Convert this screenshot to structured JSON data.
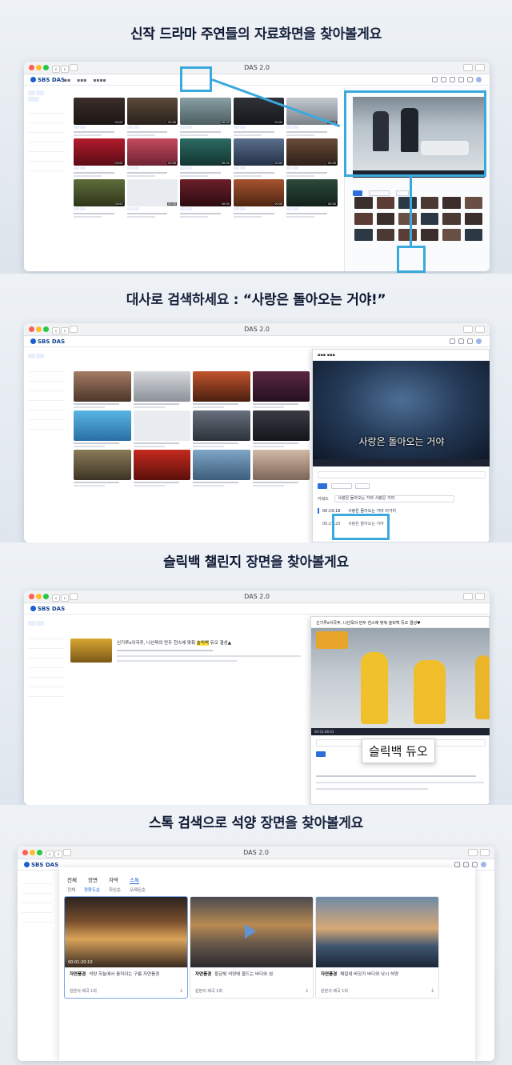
{
  "sections": [
    {
      "heading_bold": "신작 드라마 주연",
      "heading_rest": "들의 자료화면을 찾아볼게요",
      "window_title": "DAS 2.0"
    },
    {
      "heading_prefix": "대사로 검색하세요 : ",
      "heading_bold": "“사랑은 돌아오는 거야!”",
      "window_title": "DAS 2.0",
      "subtitle": "사랑은 돌아오는 거야",
      "keyword_label": "키워드",
      "keyword_value": "사랑은 돌아오는 거야 사랑은 거야",
      "result_time": "00:19:18",
      "result_text": "사랑은 돌아오는 거야 이거지",
      "result_time2": "00:19:20",
      "result_text2": "사랑은 돌아오는 거야"
    },
    {
      "heading_bold": "슬릭백 챌린지",
      "heading_rest": " 장면을 찾아볼게요",
      "window_title": "DAS 2.0",
      "player_title": "신기루x이국주, 나선욱의 만두 천스에 맞춰 슬릭백 듀오 결성♥",
      "result_title_pre": "신기루x이국주, 나선욱의 만두 천스에 맞춰 ",
      "result_title_hl": "슬릭백",
      "result_title_post": " 듀오 결성▲",
      "search_callout": "슬릭백 듀오",
      "player_time": "00:01:08:01"
    },
    {
      "heading_bold1": "스톡 검색",
      "heading_mid": "으로 ",
      "heading_bold2": "석양",
      "heading_rest": " 장면을 찾아볼게요",
      "window_title": "DAS 2.0",
      "logo": "SBS DAS",
      "tabs": [
        "전체",
        "장면",
        "자막",
        "스톡"
      ],
      "subtabs": [
        "전체",
        "정확도순",
        "최신순",
        "오래된순"
      ],
      "cards": [
        {
          "category": "자연풍경",
          "desc": "석양 하늘에서 움직이는 구름 자연풍경",
          "time": "00:01:20:10",
          "count": "원본의 왜곡 1회"
        },
        {
          "category": "자연풍경",
          "desc": "황금빛 석양에 물드는 바다와 섬",
          "time": "",
          "count": "원본의 왜곡 1회"
        },
        {
          "category": "자연풍경",
          "desc": "해질녘 바닷가 바다와 낚시 석양",
          "time": "",
          "count": "원본의 왜곡 1회"
        }
      ]
    }
  ],
  "colors": {
    "highlight": "#3aa9dd",
    "brand": "#1a5fd0",
    "keyword_highlight": "#ffe23b"
  }
}
